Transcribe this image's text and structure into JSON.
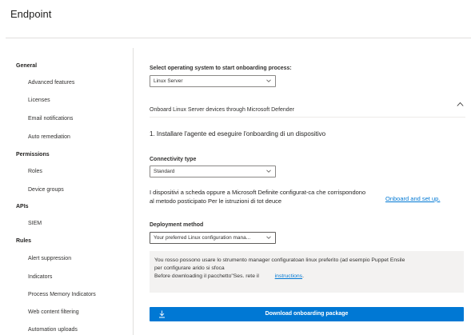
{
  "header": {
    "title": "Endpoint"
  },
  "sidebar": {
    "sections": [
      {
        "title": "General",
        "items": [
          "Advanced features",
          "Licenses",
          "Email notifications",
          "Auto remediation"
        ]
      },
      {
        "title": "Permissions",
        "items": [
          "Roles",
          "Device groups"
        ]
      },
      {
        "title": "APIs",
        "items": [
          "SIEM"
        ]
      },
      {
        "title": "Rules",
        "items": [
          "Alert suppression",
          "Indicators",
          "Process Memory Indicators",
          "Web content filtering",
          "Automation uploads"
        ]
      }
    ]
  },
  "main": {
    "os_label": "Select operating system to start onboarding process:",
    "os_value": "Linux Server",
    "section_title": "Onboard Linux Server devices through Microsoft Defender",
    "step_title": "1. Installare l'agente ed eseguire l'onboarding di un dispositivo",
    "connectivity_label": "Connectivity type",
    "connectivity_value": "Standard",
    "desc_line1": "I dispositivi a scheda oppure a Microsoft Definite configurat-ca che corrispondono",
    "desc_line2": "al metodo posticipato Per le istruzioni di tot deuce",
    "onboard_link": "Onboard and set up.",
    "deployment_label": "Deployment method",
    "deployment_value": "Your preferred Linux configuration mana...",
    "info_line1": "You rosso possono usare lo strumento manager configuratoan linux preferito (ad esempio Puppet Ensile",
    "info_line2": "per configurare arido si sfoca",
    "info_line3_prefix": "Before downloading il pacchetto\"Ses. rete il",
    "info_link": "instructions",
    "info_line3_suffix": ".",
    "download_button": "Download onboarding package"
  },
  "colors": {
    "accent": "#0078d4",
    "info_bg": "#f3f2f1"
  }
}
